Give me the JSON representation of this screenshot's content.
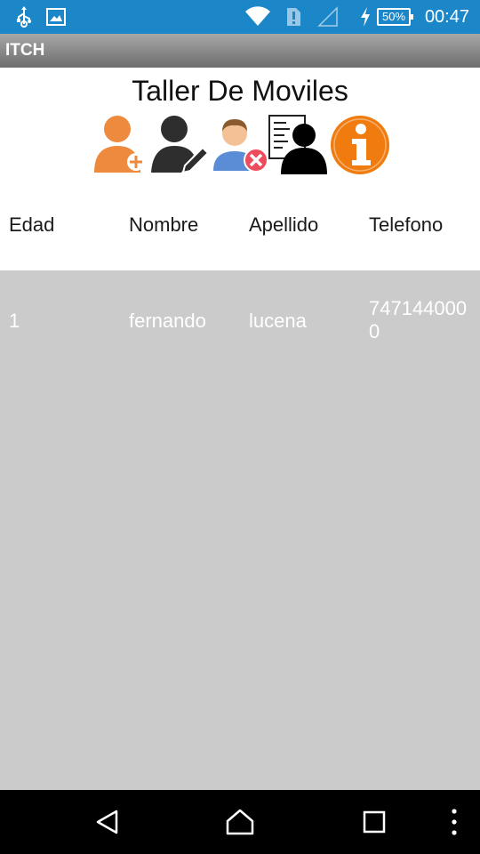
{
  "status_bar": {
    "time": "00:47",
    "battery": "50%",
    "icons": [
      "usb-icon",
      "image-icon",
      "wifi-icon",
      "alert-sim-icon",
      "no-signal-icon",
      "charging-icon",
      "battery-icon"
    ]
  },
  "app_bar": {
    "title": "ITCH"
  },
  "header": {
    "title": "Taller De Moviles",
    "actions": [
      "add-user-icon",
      "edit-user-icon",
      "delete-user-icon",
      "list-users-icon",
      "info-icon"
    ]
  },
  "table": {
    "columns": [
      "Edad",
      "Nombre",
      "Apellido",
      "Telefono"
    ],
    "rows": [
      {
        "edad": "1",
        "nombre": "fernando",
        "apellido": "lucena",
        "telefono": "7471440000"
      }
    ]
  },
  "nav_bar": {
    "buttons": [
      "back-icon",
      "home-icon",
      "recents-icon",
      "menu-overflow-icon"
    ]
  },
  "colors": {
    "status_bar": "#1b86c8",
    "app_bar": "#8a8a8a",
    "table_body": "#cbcbcb",
    "accent_orange": "#f08a1d"
  }
}
